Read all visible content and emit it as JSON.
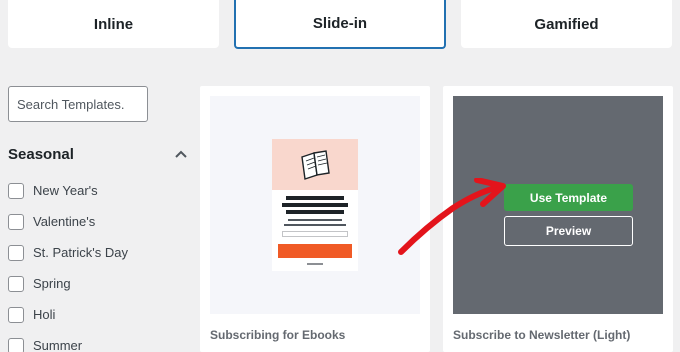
{
  "tabs": [
    {
      "label": "Inline"
    },
    {
      "label": "Slide-in",
      "selected": true
    },
    {
      "label": "Gamified"
    }
  ],
  "search": {
    "placeholder": "Search Templates."
  },
  "sidebar": {
    "section_title": "Seasonal",
    "collapse_icon": "chevron-up-icon",
    "categories": [
      {
        "label": "New Year's",
        "checked": false
      },
      {
        "label": "Valentine's",
        "checked": false
      },
      {
        "label": "St. Patrick's Day",
        "checked": false
      },
      {
        "label": "Spring",
        "checked": false
      },
      {
        "label": "Holi",
        "checked": false
      },
      {
        "label": "Summer",
        "checked": false
      }
    ]
  },
  "templates": [
    {
      "title": "Subscribing for Ebooks",
      "thumbnail_icon": "book-icon"
    },
    {
      "title": "Subscribe to Newsletter (Light)",
      "use_label": "Use Template",
      "preview_label": "Preview"
    }
  ],
  "colors": {
    "accent": "#2271b1",
    "use_button": "#3aa14a",
    "overlay": "#646970",
    "arrow": "#e3141b",
    "thumb_header": "#f9d7cd",
    "thumb_button": "#f05a26"
  }
}
